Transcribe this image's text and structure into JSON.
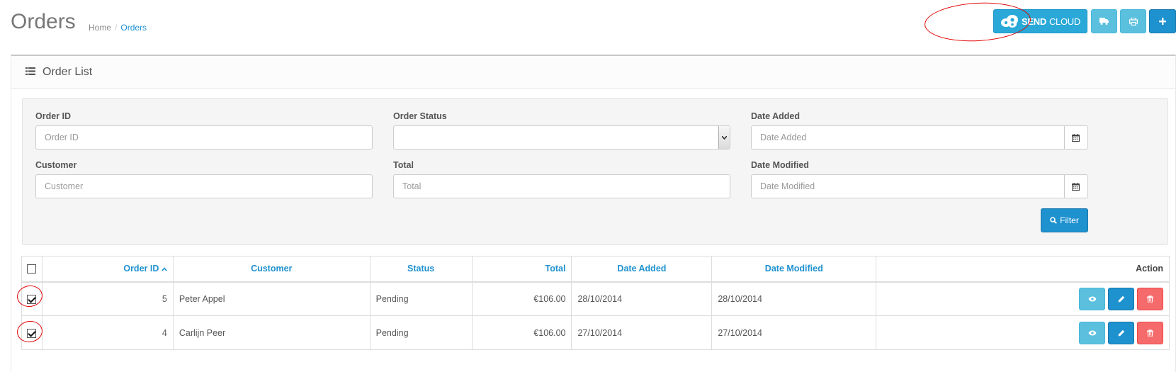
{
  "header": {
    "title": "Orders",
    "breadcrumb": [
      "Home",
      "Orders"
    ],
    "breadcrumb_separator": "/",
    "sendcloud_label_bold": "SEND",
    "sendcloud_label_light": "CLOUD"
  },
  "panel": {
    "title": "Order List"
  },
  "filters": {
    "order_id": {
      "label": "Order ID",
      "placeholder": "Order ID"
    },
    "order_status": {
      "label": "Order Status",
      "value": ""
    },
    "date_added": {
      "label": "Date Added",
      "placeholder": "Date Added"
    },
    "customer": {
      "label": "Customer",
      "placeholder": "Customer"
    },
    "total": {
      "label": "Total",
      "placeholder": "Total"
    },
    "date_modified": {
      "label": "Date Modified",
      "placeholder": "Date Modified"
    },
    "filter_button": "Filter"
  },
  "table": {
    "columns": {
      "order_id": "Order ID",
      "customer": "Customer",
      "status": "Status",
      "total": "Total",
      "date_added": "Date Added",
      "date_modified": "Date Modified",
      "action": "Action"
    },
    "sort_indicator": "^",
    "rows": [
      {
        "order_id": "5",
        "customer": "Peter Appel",
        "status": "Pending",
        "total": "€106.00",
        "date_added": "28/10/2014",
        "date_modified": "28/10/2014",
        "checked": true
      },
      {
        "order_id": "4",
        "customer": "Carlijn Peer",
        "status": "Pending",
        "total": "€106.00",
        "date_added": "27/10/2014",
        "date_modified": "27/10/2014",
        "checked": true
      }
    ]
  },
  "colors": {
    "primary": "#1e91cf",
    "info": "#5bc0de",
    "danger": "#f56b6b",
    "annotation": "#e00000"
  },
  "icons": [
    "sendcloud-logo-icon",
    "truck-icon",
    "print-icon",
    "plus-icon",
    "list-icon",
    "calendar-icon",
    "search-icon",
    "eye-icon",
    "pencil-icon",
    "trash-icon",
    "caret-down-icon"
  ]
}
